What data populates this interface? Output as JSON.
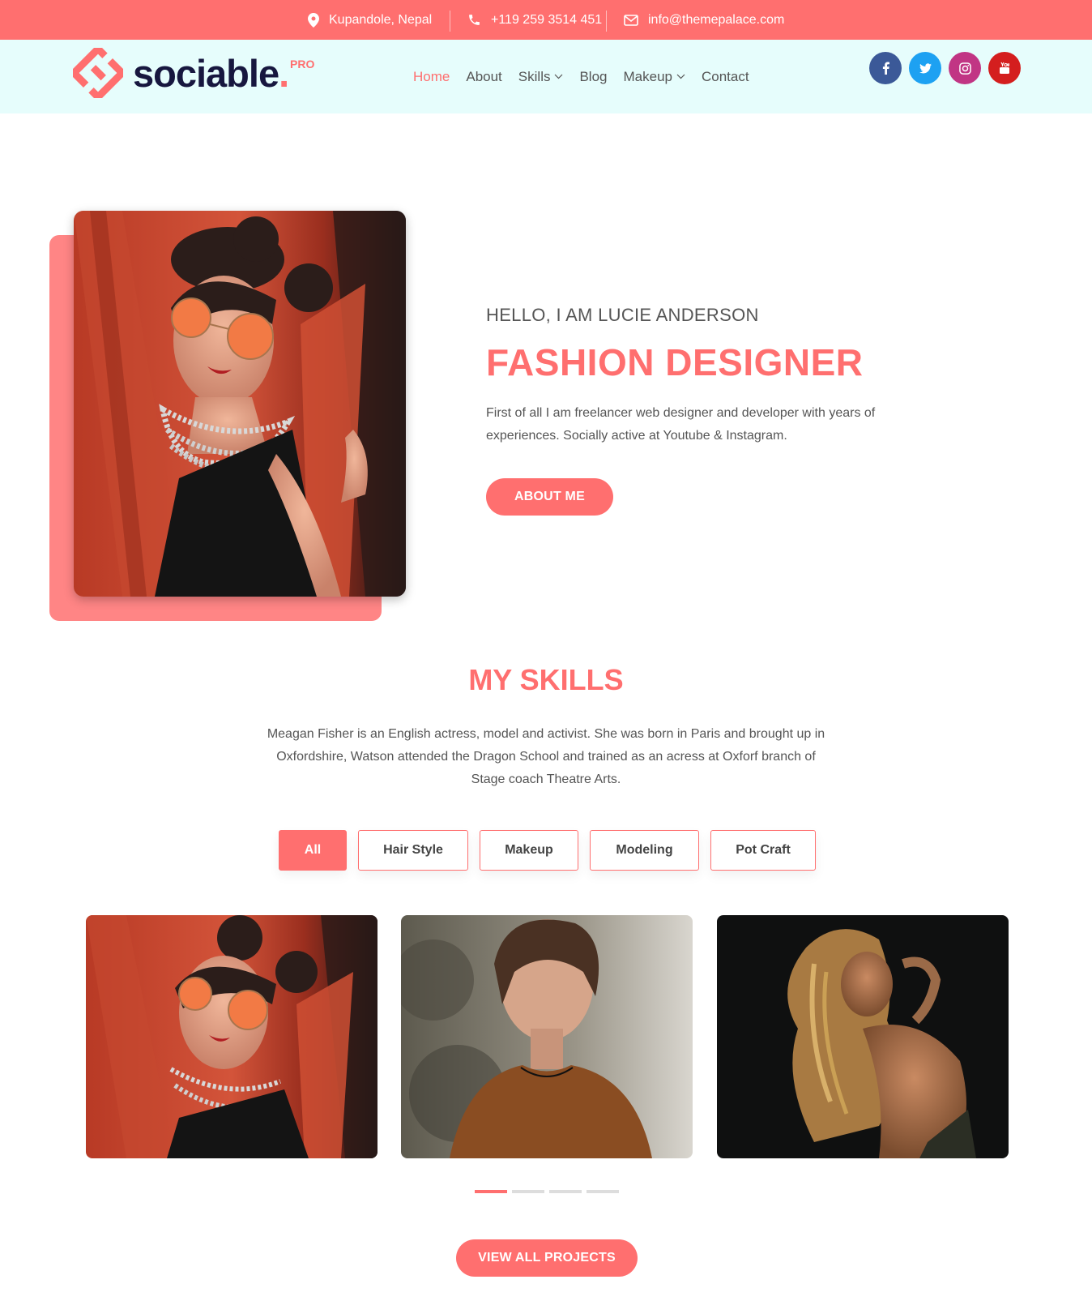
{
  "topbar": {
    "location": "Kupandole, Nepal",
    "phone": "+119 259 3514 451",
    "email": "info@themepalace.com"
  },
  "brand": {
    "name": "sociable",
    "dot": ".",
    "badge": "PRO"
  },
  "nav": {
    "items": [
      {
        "label": "Home",
        "active": true,
        "dropdown": false
      },
      {
        "label": "About",
        "active": false,
        "dropdown": false
      },
      {
        "label": "Skills",
        "active": false,
        "dropdown": true
      },
      {
        "label": "Blog",
        "active": false,
        "dropdown": false
      },
      {
        "label": "Makeup",
        "active": false,
        "dropdown": true
      },
      {
        "label": "Contact",
        "active": false,
        "dropdown": false
      }
    ]
  },
  "socials": [
    {
      "name": "facebook",
      "icon": "facebook-icon",
      "color": "#3b5998"
    },
    {
      "name": "twitter",
      "icon": "twitter-icon",
      "color": "#1da1f2"
    },
    {
      "name": "instagram",
      "icon": "instagram-icon",
      "color": "#c13584"
    },
    {
      "name": "youtube",
      "icon": "youtube-icon",
      "color": "#d41e1e"
    }
  ],
  "hero": {
    "subtitle": "HELLO, I AM LUCIE ANDERSON",
    "title": "FASHION DESIGNER",
    "text": "First of all I am freelancer web designer and developer with years of experiences. Socially active at Youtube & Instagram.",
    "button": "ABOUT ME"
  },
  "skills": {
    "title": "MY SKILLS",
    "text": "Meagan Fisher is an English actress, model and activist. She was born in Paris and brought up in Oxfordshire, Watson attended the Dragon School and trained as an acress at Oxforf branch of Stage coach Theatre Arts.",
    "filters": [
      "All",
      "Hair Style",
      "Makeup",
      "Modeling",
      "Pot Craft"
    ],
    "active_filter": "All",
    "slider_pages": 4,
    "active_page": 1,
    "button": "VIEW ALL PROJECTS"
  },
  "colors": {
    "accent": "#ff6f6f",
    "header_bg": "#e6fdfc",
    "brand_dark": "#17173f"
  }
}
